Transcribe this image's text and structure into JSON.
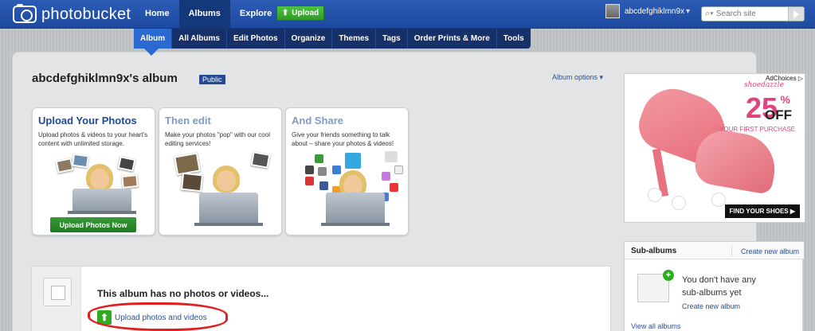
{
  "brand": {
    "name": "photobucket"
  },
  "topnav": [
    {
      "label": "Home",
      "active": false
    },
    {
      "label": "Albums",
      "active": true
    },
    {
      "label": "Explore",
      "active": false
    }
  ],
  "upload_button": {
    "label": "Upload"
  },
  "user": {
    "name": "abcdefghiklmn9x",
    "menu_glyph": "▾"
  },
  "search": {
    "placeholder": "Search site",
    "icon": "search-icon"
  },
  "subnav": [
    {
      "label": "Album",
      "active": true
    },
    {
      "label": "All Albums",
      "active": false
    },
    {
      "label": "Edit Photos",
      "active": false
    },
    {
      "label": "Organize",
      "active": false
    },
    {
      "label": "Themes",
      "active": false
    },
    {
      "label": "Tags",
      "active": false
    },
    {
      "label": "Order Prints & More",
      "active": false
    },
    {
      "label": "Tools",
      "active": false
    }
  ],
  "album": {
    "title": "abcdefghiklmn9x's album",
    "badge": "Public",
    "options_label": "Album options ▾"
  },
  "cards": [
    {
      "title": "Upload Your Photos",
      "text": "Upload photos & videos to your heart's content with unlimited storage.",
      "cta": "Upload Photos Now"
    },
    {
      "title": "Then edit",
      "text": "Make your photos \"pop\" with our cool editing services!",
      "cta": ""
    },
    {
      "title": "And Share",
      "text": "Give your friends something to talk about – share your photos & videos!",
      "cta": ""
    }
  ],
  "empty_state": {
    "message": "This album has no photos or videos...",
    "upload_link": "Upload photos and videos"
  },
  "ad": {
    "adchoices": "AdChoices ▷",
    "brand": "shoedazzle",
    "percent": "25",
    "percent_symbol": "%",
    "off": "OFF",
    "sub": "YOUR FIRST PURCHASE",
    "cta": "FIND YOUR SHOES ▶"
  },
  "subalbums": {
    "title": "Sub-albums",
    "create_label": "Create new album",
    "empty_text": "You don't have any sub-albums yet",
    "create_link": "Create new album",
    "view_all": "View all albums"
  },
  "colors": {
    "topbar": "#1d4aa0",
    "accent_green": "#2eab1f",
    "link": "#2a4f9a",
    "annotation_red": "#e02020"
  }
}
